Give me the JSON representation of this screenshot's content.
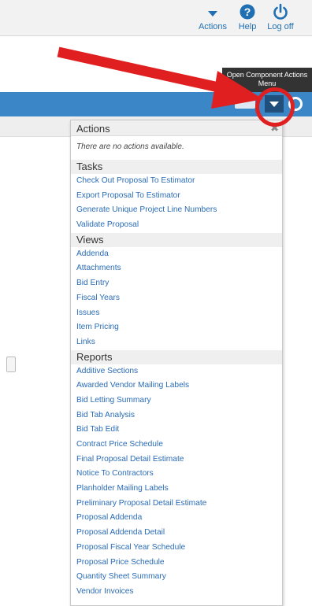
{
  "toolbar": {
    "actions_label": "Actions",
    "help_label": "Help",
    "logoff_label": "Log off"
  },
  "tooltip": {
    "text": "Open Component Actions Menu"
  },
  "colors": {
    "bar_blue": "#3b86c6",
    "link": "#2a6cb6",
    "highlight_red": "#e02020"
  },
  "panel": {
    "title": "Actions",
    "empty_text": "There are no actions available.",
    "tasks_header": "Tasks",
    "tasks": [
      "Check Out Proposal To Estimator",
      "Export Proposal To Estimator",
      "Generate Unique Project Line Numbers",
      "Validate Proposal"
    ],
    "views_header": "Views",
    "views": [
      "Addenda",
      "Attachments",
      "Bid Entry",
      "Fiscal Years",
      "Issues",
      "Item Pricing",
      "Links"
    ],
    "reports_header": "Reports",
    "reports": [
      "Additive Sections",
      "Awarded Vendor Mailing Labels",
      "Bid Letting Summary",
      "Bid Tab Analysis",
      "Bid Tab Edit",
      "Contract Price Schedule",
      "Final Proposal Detail Estimate",
      "Notice To Contractors",
      "Planholder Mailing Labels",
      "Preliminary Proposal Detail Estimate",
      "Proposal Addenda",
      "Proposal Addenda Detail",
      "Proposal Fiscal Year Schedule",
      "Proposal Price Schedule",
      "Quantity Sheet Summary",
      "Vendor Invoices"
    ]
  }
}
